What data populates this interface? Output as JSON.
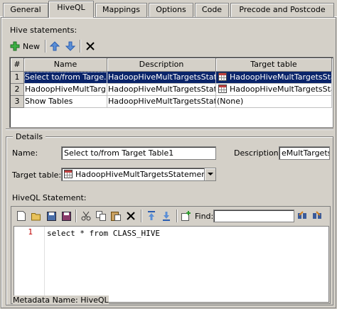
{
  "tabs": [
    {
      "label": "General"
    },
    {
      "label": "HiveQL"
    },
    {
      "label": "Mappings"
    },
    {
      "label": "Options"
    },
    {
      "label": "Code"
    },
    {
      "label": "Precode and Postcode"
    }
  ],
  "statements": {
    "section_label": "Hive statements:",
    "new_label": "New",
    "columns": {
      "num": "#",
      "name": "Name",
      "description": "Description",
      "target": "Target table"
    },
    "rows": [
      {
        "num": "1",
        "name": "Select to/from Targe...",
        "description": "HadoopHiveMultTargetsStat...",
        "target": "HadoopHiveMultTargetsSta..."
      },
      {
        "num": "2",
        "name": "HadoopHiveMultTarg...",
        "description": "HadoopHiveMultTargetsStat...",
        "target": "HadoopHiveMultTargetsSta..."
      },
      {
        "num": "3",
        "name": "Show Tables",
        "description": "HadoopHiveMultTargetsStat...",
        "target": "(None)"
      }
    ]
  },
  "details": {
    "legend": "Details",
    "name_label": "Name:",
    "name_value": "Select to/from Target Table1",
    "description_label": "Description:",
    "description_value": "eMultTargetsS",
    "target_label": "Target table:",
    "target_value": "HadoopHiveMultTargetsStatemen...",
    "hiveql_label": "HiveQL Statement:",
    "find_label": "Find:",
    "find_value": "",
    "line_number": "1",
    "code": "select * from CLASS_HIVE"
  },
  "status": {
    "text": "Metadata Name: HiveQL"
  },
  "colors": {
    "selection": "#0a246a",
    "window": "#d4d0c8",
    "line_number": "#c00000"
  }
}
